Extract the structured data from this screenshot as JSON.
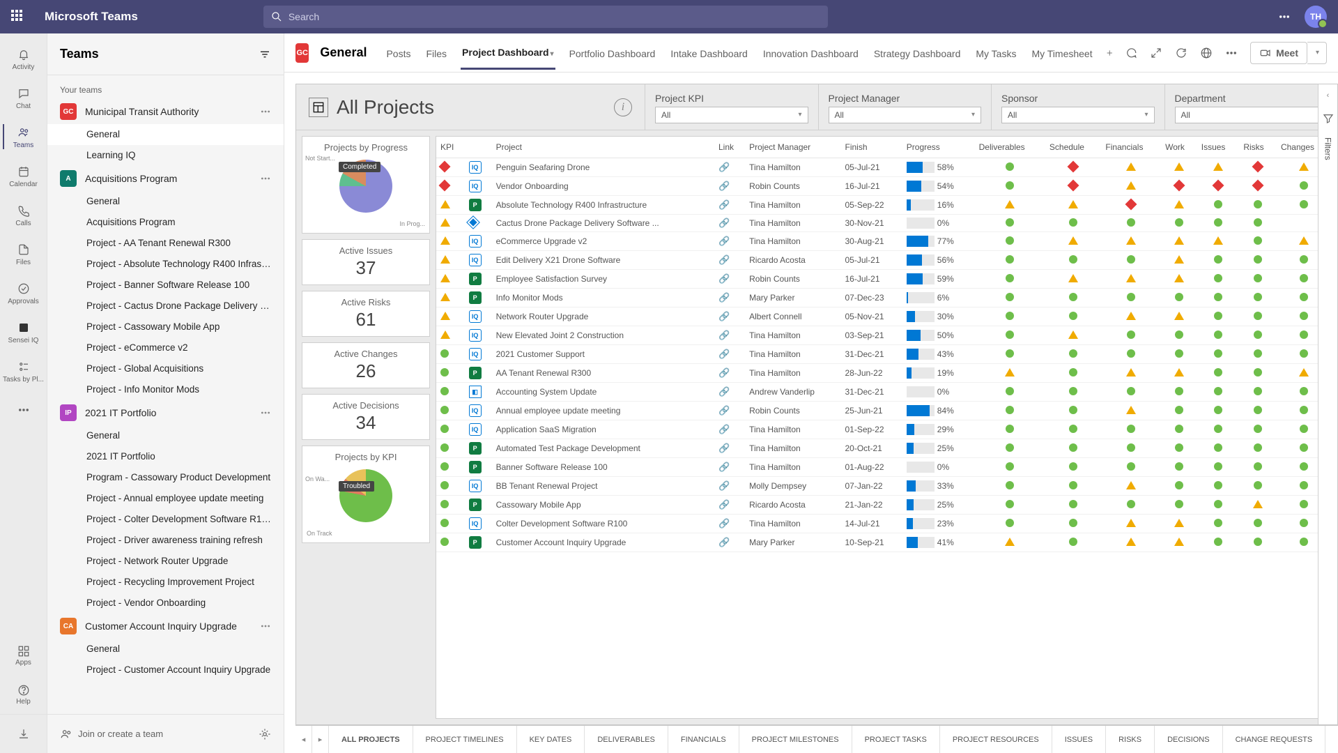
{
  "topbar": {
    "app_name": "Microsoft Teams",
    "search_placeholder": "Search",
    "avatar_initials": "TH"
  },
  "rail": [
    {
      "label": "Activity",
      "icon": "bell"
    },
    {
      "label": "Chat",
      "icon": "chat"
    },
    {
      "label": "Teams",
      "icon": "teams",
      "active": true
    },
    {
      "label": "Calendar",
      "icon": "calendar"
    },
    {
      "label": "Calls",
      "icon": "calls"
    },
    {
      "label": "Files",
      "icon": "files"
    },
    {
      "label": "Approvals",
      "icon": "approvals"
    },
    {
      "label": "Sensei IQ",
      "icon": "sensei"
    },
    {
      "label": "Tasks by Pl...",
      "icon": "tasks"
    }
  ],
  "rail_more": {
    "label": "Apps"
  },
  "rail_help": {
    "label": "Help"
  },
  "sidebar": {
    "title": "Teams",
    "section": "Your teams",
    "join_link": "Join or create a team",
    "teams": [
      {
        "name": "Municipal Transit Authority",
        "tile": "GC",
        "color": "#e23838",
        "channels": [
          {
            "name": "General",
            "active": true
          },
          {
            "name": "Learning IQ"
          }
        ]
      },
      {
        "name": "Acquisitions Program",
        "tile": "A",
        "color": "#0f7b6c",
        "channels": [
          {
            "name": "General"
          },
          {
            "name": "Acquisitions Program"
          },
          {
            "name": "Project - AA Tenant Renewal R300"
          },
          {
            "name": "Project - Absolute Technology R400 Infrastr..."
          },
          {
            "name": "Project - Banner Software Release 100"
          },
          {
            "name": "Project - Cactus Drone Package Delivery Sof..."
          },
          {
            "name": "Project - Cassowary Mobile App"
          },
          {
            "name": "Project - eCommerce v2"
          },
          {
            "name": "Project - Global Acquisitions"
          },
          {
            "name": "Project - Info Monitor Mods"
          }
        ]
      },
      {
        "name": "2021 IT Portfolio",
        "tile": "IP",
        "color": "#b146c2",
        "channels": [
          {
            "name": "General"
          },
          {
            "name": "2021 IT Portfolio"
          },
          {
            "name": "Program - Cassowary Product Development"
          },
          {
            "name": "Project - Annual employee update meeting"
          },
          {
            "name": "Project - Colter Development Software R100"
          },
          {
            "name": "Project - Driver awareness training refresh"
          },
          {
            "name": "Project - Network Router Upgrade"
          },
          {
            "name": "Project - Recycling Improvement Project"
          },
          {
            "name": "Project - Vendor Onboarding"
          }
        ]
      },
      {
        "name": "Customer Account Inquiry Upgrade",
        "tile": "CA",
        "color": "#e8762c",
        "channels": [
          {
            "name": "General"
          },
          {
            "name": "Project - Customer Account Inquiry Upgrade"
          }
        ]
      }
    ]
  },
  "channel_header": {
    "tile": "GC",
    "title": "General",
    "tabs": [
      "Posts",
      "Files",
      "Project Dashboard",
      "Portfolio Dashboard",
      "Intake Dashboard",
      "Innovation Dashboard",
      "Strategy Dashboard",
      "My Tasks",
      "My Timesheet"
    ],
    "active_tab": 2,
    "meet": "Meet"
  },
  "dashboard": {
    "title": "All Projects",
    "filters": [
      {
        "label": "Project KPI",
        "value": "All"
      },
      {
        "label": "Project Manager",
        "value": "All"
      },
      {
        "label": "Sponsor",
        "value": "All"
      },
      {
        "label": "Department",
        "value": "All"
      }
    ],
    "cards": {
      "progress_title": "Projects by Progress",
      "progress_labels": {
        "completed": "Completed",
        "not_started": "Not Start...",
        "in_prog": "In Prog..."
      },
      "issues_title": "Active Issues",
      "issues": "37",
      "risks_title": "Active Risks",
      "risks": "61",
      "changes_title": "Active Changes",
      "changes": "26",
      "decisions_title": "Active Decisions",
      "decisions": "34",
      "kpi_title": "Projects by KPI",
      "kpi_labels": {
        "troubled": "Troubled",
        "on_watch": "On Wa...",
        "on_track": "On Track"
      }
    },
    "columns": [
      "KPI",
      "",
      "Project",
      "Link",
      "Project Manager",
      "Finish",
      "Progress",
      "Deliverables",
      "Schedule",
      "Financials",
      "Work",
      "Issues",
      "Risks",
      "Changes"
    ],
    "rows": [
      {
        "kpi": "r",
        "pt": "iq",
        "project": "Penguin Seafaring Drone",
        "pm": "Tina Hamilton",
        "finish": "05-Jul-21",
        "prog": 58,
        "ind": [
          "g",
          "r",
          "y",
          "y",
          "y",
          "r",
          "y"
        ]
      },
      {
        "kpi": "r",
        "pt": "iq",
        "project": "Vendor Onboarding",
        "pm": "Robin Counts",
        "finish": "16-Jul-21",
        "prog": 54,
        "ind": [
          "g",
          "r",
          "y",
          "r",
          "r",
          "r",
          "g"
        ]
      },
      {
        "kpi": "y",
        "pt": "pp",
        "project": "Absolute Technology R400 Infrastructure",
        "pm": "Tina Hamilton",
        "finish": "05-Sep-22",
        "prog": 16,
        "ind": [
          "y",
          "y",
          "r",
          "y",
          "g",
          "g",
          "g"
        ]
      },
      {
        "kpi": "y",
        "pt": "b",
        "project": "Cactus Drone Package Delivery Software ...",
        "pm": "Tina Hamilton",
        "finish": "30-Nov-21",
        "prog": 0,
        "ind": [
          "g",
          "g",
          "g",
          "g",
          "g",
          "g",
          ""
        ]
      },
      {
        "kpi": "y",
        "pt": "iq",
        "project": "eCommerce Upgrade v2",
        "pm": "Tina Hamilton",
        "finish": "30-Aug-21",
        "prog": 77,
        "ind": [
          "g",
          "y",
          "y",
          "y",
          "y",
          "g",
          "y"
        ]
      },
      {
        "kpi": "y",
        "pt": "iq",
        "project": "Edit Delivery X21 Drone Software",
        "pm": "Ricardo Acosta",
        "finish": "05-Jul-21",
        "prog": 56,
        "ind": [
          "g",
          "g",
          "g",
          "y",
          "g",
          "g",
          "g"
        ]
      },
      {
        "kpi": "y",
        "pt": "pp",
        "project": "Employee Satisfaction Survey",
        "pm": "Robin Counts",
        "finish": "16-Jul-21",
        "prog": 59,
        "ind": [
          "g",
          "y",
          "y",
          "y",
          "g",
          "g",
          "g"
        ]
      },
      {
        "kpi": "y",
        "pt": "pp",
        "project": "Info Monitor Mods",
        "pm": "Mary Parker",
        "finish": "07-Dec-23",
        "prog": 6,
        "ind": [
          "g",
          "g",
          "g",
          "g",
          "g",
          "g",
          "g"
        ]
      },
      {
        "kpi": "y",
        "pt": "iq",
        "project": "Network Router Upgrade",
        "pm": "Albert Connell",
        "finish": "05-Nov-21",
        "prog": 30,
        "ind": [
          "g",
          "g",
          "y",
          "y",
          "g",
          "g",
          "g"
        ]
      },
      {
        "kpi": "y",
        "pt": "iq",
        "project": "New Elevated Joint 2 Construction",
        "pm": "Tina Hamilton",
        "finish": "03-Sep-21",
        "prog": 50,
        "ind": [
          "g",
          "y",
          "g",
          "g",
          "g",
          "g",
          "g"
        ]
      },
      {
        "kpi": "g",
        "pt": "iq",
        "project": "2021 Customer Support",
        "pm": "Tina Hamilton",
        "finish": "31-Dec-21",
        "prog": 43,
        "ind": [
          "g",
          "g",
          "g",
          "g",
          "g",
          "g",
          "g"
        ]
      },
      {
        "kpi": "g",
        "pt": "pp",
        "project": "AA Tenant Renewal R300",
        "pm": "Tina Hamilton",
        "finish": "28-Jun-22",
        "prog": 19,
        "ind": [
          "y",
          "g",
          "y",
          "y",
          "g",
          "g",
          "y"
        ]
      },
      {
        "kpi": "g",
        "pt": "sp",
        "project": "Accounting System Update",
        "pm": "Andrew Vanderlip",
        "finish": "31-Dec-21",
        "prog": 0,
        "ind": [
          "g",
          "g",
          "g",
          "g",
          "g",
          "g",
          "g"
        ]
      },
      {
        "kpi": "g",
        "pt": "iq",
        "project": "Annual employee update meeting",
        "pm": "Robin Counts",
        "finish": "25-Jun-21",
        "prog": 84,
        "ind": [
          "g",
          "g",
          "y",
          "g",
          "g",
          "g",
          "g"
        ]
      },
      {
        "kpi": "g",
        "pt": "iq",
        "project": "Application SaaS Migration",
        "pm": "Tina Hamilton",
        "finish": "01-Sep-22",
        "prog": 29,
        "ind": [
          "g",
          "g",
          "g",
          "g",
          "g",
          "g",
          "g"
        ]
      },
      {
        "kpi": "g",
        "pt": "pp",
        "project": "Automated Test Package Development",
        "pm": "Tina Hamilton",
        "finish": "20-Oct-21",
        "prog": 25,
        "ind": [
          "g",
          "g",
          "g",
          "g",
          "g",
          "g",
          "g"
        ]
      },
      {
        "kpi": "g",
        "pt": "pp",
        "project": "Banner Software Release 100",
        "pm": "Tina Hamilton",
        "finish": "01-Aug-22",
        "prog": 0,
        "ind": [
          "g",
          "g",
          "g",
          "g",
          "g",
          "g",
          "g"
        ]
      },
      {
        "kpi": "g",
        "pt": "iq",
        "project": "BB Tenant Renewal Project",
        "pm": "Molly Dempsey",
        "finish": "07-Jan-22",
        "prog": 33,
        "ind": [
          "g",
          "g",
          "y",
          "g",
          "g",
          "g",
          "g"
        ]
      },
      {
        "kpi": "g",
        "pt": "pp",
        "project": "Cassowary Mobile App",
        "pm": "Ricardo Acosta",
        "finish": "21-Jan-22",
        "prog": 25,
        "ind": [
          "g",
          "g",
          "g",
          "g",
          "g",
          "y",
          "g"
        ]
      },
      {
        "kpi": "g",
        "pt": "iq",
        "project": "Colter Development Software R100",
        "pm": "Tina Hamilton",
        "finish": "14-Jul-21",
        "prog": 23,
        "ind": [
          "g",
          "g",
          "y",
          "y",
          "g",
          "g",
          "g"
        ]
      },
      {
        "kpi": "g",
        "pt": "pp",
        "project": "Customer Account Inquiry Upgrade",
        "pm": "Mary Parker",
        "finish": "10-Sep-21",
        "prog": 41,
        "ind": [
          "y",
          "g",
          "y",
          "y",
          "g",
          "g",
          "g"
        ]
      }
    ],
    "bottom_tabs": [
      "ALL PROJECTS",
      "PROJECT TIMELINES",
      "KEY DATES",
      "DELIVERABLES",
      "FINANCIALS",
      "PROJECT MILESTONES",
      "PROJECT TASKS",
      "PROJECT RESOURCES",
      "ISSUES",
      "RISKS",
      "DECISIONS",
      "CHANGE REQUESTS"
    ],
    "filters_rail": "Filters"
  }
}
